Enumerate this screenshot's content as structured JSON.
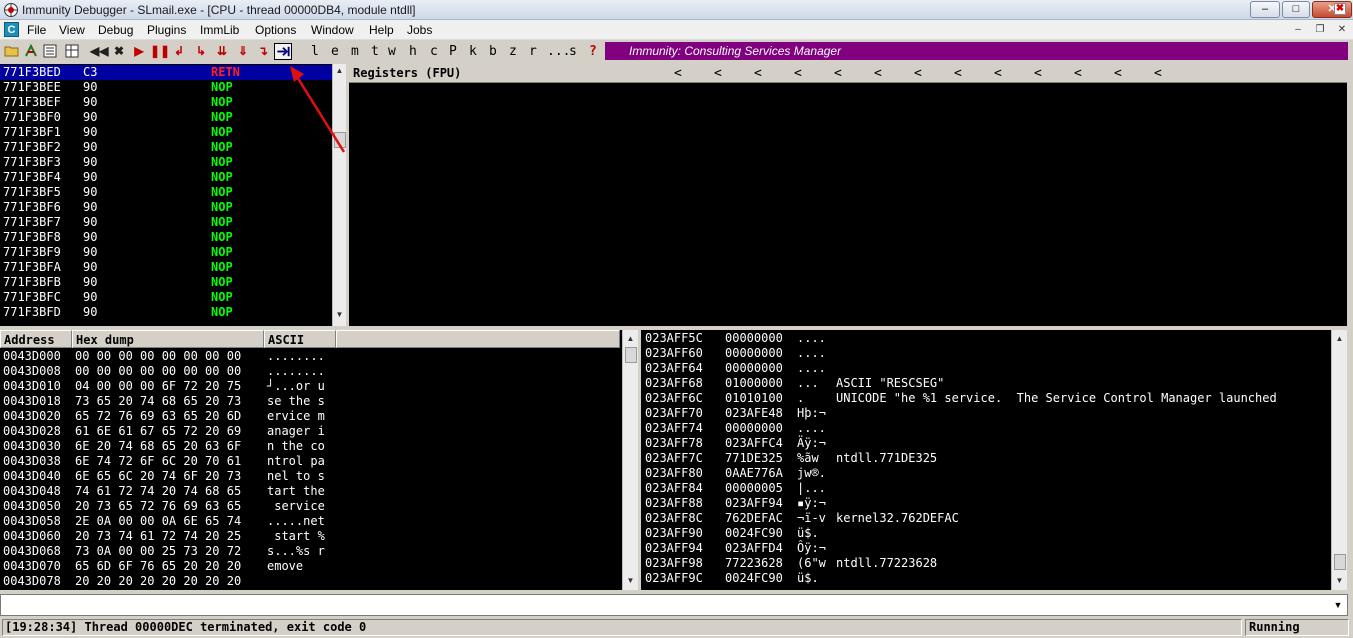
{
  "window": {
    "title": "Immunity Debugger - SLmail.exe - [CPU - thread 00000DB4, module ntdll]",
    "minimize": "–",
    "maximize": "□",
    "close": "✕"
  },
  "menu": {
    "items": [
      "File",
      "View",
      "Debug",
      "Plugins",
      "ImmLib",
      "Options",
      "Window",
      "Help",
      "Jobs"
    ],
    "app_icon_letter": "C"
  },
  "toolbar": {
    "letters": [
      "l",
      "e",
      "m",
      "t",
      "w",
      "h",
      "c",
      "P",
      "k",
      "b",
      "z",
      "r",
      "...",
      "s",
      "?"
    ],
    "banner": "Immunity: Consulting Services Manager",
    "banner_close": "✖"
  },
  "disasm": {
    "rows": [
      {
        "addr": "771F3BED",
        "hex": "C3",
        "op": "RETN"
      },
      {
        "addr": "771F3BEE",
        "hex": "90",
        "op": "NOP"
      },
      {
        "addr": "771F3BEF",
        "hex": "90",
        "op": "NOP"
      },
      {
        "addr": "771F3BF0",
        "hex": "90",
        "op": "NOP"
      },
      {
        "addr": "771F3BF1",
        "hex": "90",
        "op": "NOP"
      },
      {
        "addr": "771F3BF2",
        "hex": "90",
        "op": "NOP"
      },
      {
        "addr": "771F3BF3",
        "hex": "90",
        "op": "NOP"
      },
      {
        "addr": "771F3BF4",
        "hex": "90",
        "op": "NOP"
      },
      {
        "addr": "771F3BF5",
        "hex": "90",
        "op": "NOP"
      },
      {
        "addr": "771F3BF6",
        "hex": "90",
        "op": "NOP"
      },
      {
        "addr": "771F3BF7",
        "hex": "90",
        "op": "NOP"
      },
      {
        "addr": "771F3BF8",
        "hex": "90",
        "op": "NOP"
      },
      {
        "addr": "771F3BF9",
        "hex": "90",
        "op": "NOP"
      },
      {
        "addr": "771F3BFA",
        "hex": "90",
        "op": "NOP"
      },
      {
        "addr": "771F3BFB",
        "hex": "90",
        "op": "NOP"
      },
      {
        "addr": "771F3BFC",
        "hex": "90",
        "op": "NOP"
      },
      {
        "addr": "771F3BFD",
        "hex": "90",
        "op": "NOP"
      }
    ]
  },
  "registers": {
    "title": "Registers (FPU)",
    "chevron": "<"
  },
  "dump": {
    "headers": {
      "address": "Address",
      "hex": "Hex dump",
      "ascii": "ASCII"
    },
    "rows": [
      {
        "addr": "0043D000",
        "hex": "00 00 00 00 00 00 00 00",
        "ascii": "........"
      },
      {
        "addr": "0043D008",
        "hex": "00 00 00 00 00 00 00 00",
        "ascii": "........"
      },
      {
        "addr": "0043D010",
        "hex": "04 00 00 00 6F 72 20 75",
        "ascii": "┘...or u"
      },
      {
        "addr": "0043D018",
        "hex": "73 65 20 74 68 65 20 73",
        "ascii": "se the s"
      },
      {
        "addr": "0043D020",
        "hex": "65 72 76 69 63 65 20 6D",
        "ascii": "ervice m"
      },
      {
        "addr": "0043D028",
        "hex": "61 6E 61 67 65 72 20 69",
        "ascii": "anager i"
      },
      {
        "addr": "0043D030",
        "hex": "6E 20 74 68 65 20 63 6F",
        "ascii": "n the co"
      },
      {
        "addr": "0043D038",
        "hex": "6E 74 72 6F 6C 20 70 61",
        "ascii": "ntrol pa"
      },
      {
        "addr": "0043D040",
        "hex": "6E 65 6C 20 74 6F 20 73",
        "ascii": "nel to s"
      },
      {
        "addr": "0043D048",
        "hex": "74 61 72 74 20 74 68 65",
        "ascii": "tart the"
      },
      {
        "addr": "0043D050",
        "hex": "20 73 65 72 76 69 63 65",
        "ascii": " service"
      },
      {
        "addr": "0043D058",
        "hex": "2E 0A 00 00 0A 6E 65 74",
        "ascii": ".....net"
      },
      {
        "addr": "0043D060",
        "hex": "20 73 74 61 72 74 20 25",
        "ascii": " start %"
      },
      {
        "addr": "0043D068",
        "hex": "73 0A 00 00 25 73 20 72",
        "ascii": "s...%s r"
      },
      {
        "addr": "0043D070",
        "hex": "65 6D 6F 76 65 20 20 20",
        "ascii": "emove"
      },
      {
        "addr": "0043D078",
        "hex": "20 20 20 20 20 20 20 20",
        "ascii": ""
      }
    ]
  },
  "stack": {
    "rows": [
      {
        "addr": "023AFF5C",
        "val": "00000000",
        "asc": "....",
        "cmt": ""
      },
      {
        "addr": "023AFF60",
        "val": "00000000",
        "asc": "....",
        "cmt": ""
      },
      {
        "addr": "023AFF64",
        "val": "00000000",
        "asc": "....",
        "cmt": ""
      },
      {
        "addr": "023AFF68",
        "val": "01000000",
        "asc": "...",
        "cmt": "ASCII \"RESCSEG\""
      },
      {
        "addr": "023AFF6C",
        "val": "01010100",
        "asc": ".",
        "cmt": "UNICODE \"he %1 service.  The Service Control Manager launched"
      },
      {
        "addr": "023AFF70",
        "val": "023AFE48",
        "asc": "Hþ:¬",
        "cmt": ""
      },
      {
        "addr": "023AFF74",
        "val": "00000000",
        "asc": "....",
        "cmt": ""
      },
      {
        "addr": "023AFF78",
        "val": "023AFFC4",
        "asc": "Äÿ:¬",
        "cmt": ""
      },
      {
        "addr": "023AFF7C",
        "val": "771DE325",
        "asc": "%ãw",
        "cmt": "ntdll.771DE325"
      },
      {
        "addr": "023AFF80",
        "val": "0AAE776A",
        "asc": "jw®.",
        "cmt": ""
      },
      {
        "addr": "023AFF84",
        "val": "00000005",
        "asc": "|...",
        "cmt": ""
      },
      {
        "addr": "023AFF88",
        "val": "023AFF94",
        "asc": "▪ÿ:¬",
        "cmt": ""
      },
      {
        "addr": "023AFF8C",
        "val": "762DEFAC",
        "asc": "¬ï-v",
        "cmt": "kernel32.762DEFAC"
      },
      {
        "addr": "023AFF90",
        "val": "0024FC90",
        "asc": "ü$.",
        "cmt": ""
      },
      {
        "addr": "023AFF94",
        "val": "023AFFD4",
        "asc": "Ôÿ:¬",
        "cmt": ""
      },
      {
        "addr": "023AFF98",
        "val": "77223628",
        "asc": "(6\"w",
        "cmt": "ntdll.77223628"
      },
      {
        "addr": "023AFF9C",
        "val": "0024FC90",
        "asc": "ü$.",
        "cmt": ""
      }
    ]
  },
  "command": {
    "value": "",
    "placeholder": ""
  },
  "status": {
    "message": "[19:28:34] Thread 00000DEC terminated, exit code 0",
    "state": "Running"
  },
  "colors": {
    "banner": "#800080",
    "selection": "#0000a0",
    "nop": "#00ff00",
    "retn": "#ff2020"
  }
}
